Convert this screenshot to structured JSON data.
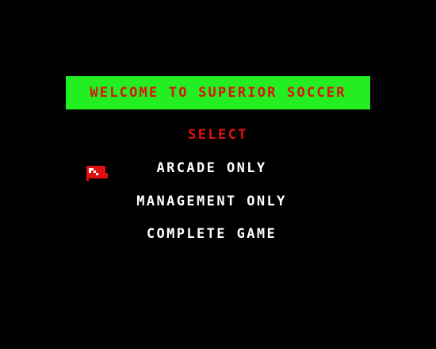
{
  "title": "WELCOME TO SUPERIOR SOCCER",
  "select_label": "SELECT",
  "menu": {
    "items": [
      {
        "label": "ARCADE ONLY"
      },
      {
        "label": "MANAGEMENT ONLY"
      },
      {
        "label": "COMPLETE GAME"
      }
    ],
    "selected_index": 0
  },
  "cursor_icon": "pointing-hand-icon",
  "colors": {
    "background": "#000000",
    "title_bar": "#22ee22",
    "title_text": "#e01010",
    "select_text": "#e01010",
    "menu_text": "#ffffff",
    "cursor": "#e01010"
  }
}
